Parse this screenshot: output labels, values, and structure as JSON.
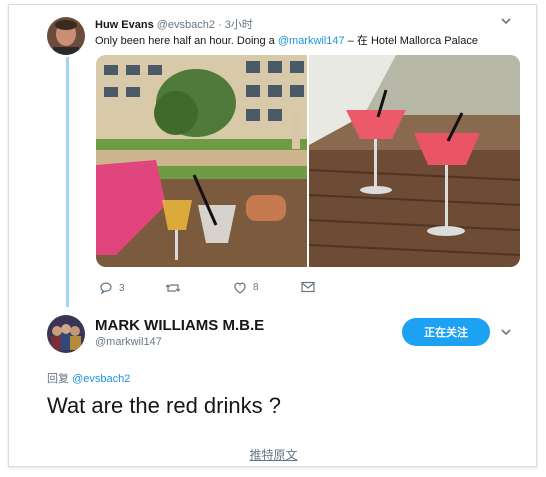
{
  "original_tweet": {
    "author_name": "Huw Evans",
    "author_handle": "@evsbach2",
    "timestamp": "· 3小时",
    "text_prefix": "Only been here half an hour. Doing a ",
    "mention": "@markwil147",
    "location_sep": " – 在 ",
    "location": "Hotel Mallorca Palace",
    "actions": {
      "reply_count": "3",
      "retweet_count": "",
      "like_count": "8"
    }
  },
  "reply_tweet": {
    "author_name": "MARK WILLIAMS M.B.E",
    "author_handle": "@markwil147",
    "follow_label": "正在关注",
    "reply_prefix": "回复 ",
    "reply_to_handle": "@evsbach2",
    "text": "Wat are the red drinks ?"
  },
  "footer": {
    "view_original": "推特原文"
  },
  "colors": {
    "accent": "#1da1f2",
    "link": "#1b95e0",
    "muted": "#657786",
    "thread_line": "#a4d4f5"
  },
  "icons": [
    "chevron-down-icon",
    "reply-icon",
    "retweet-icon",
    "like-icon",
    "message-icon"
  ]
}
